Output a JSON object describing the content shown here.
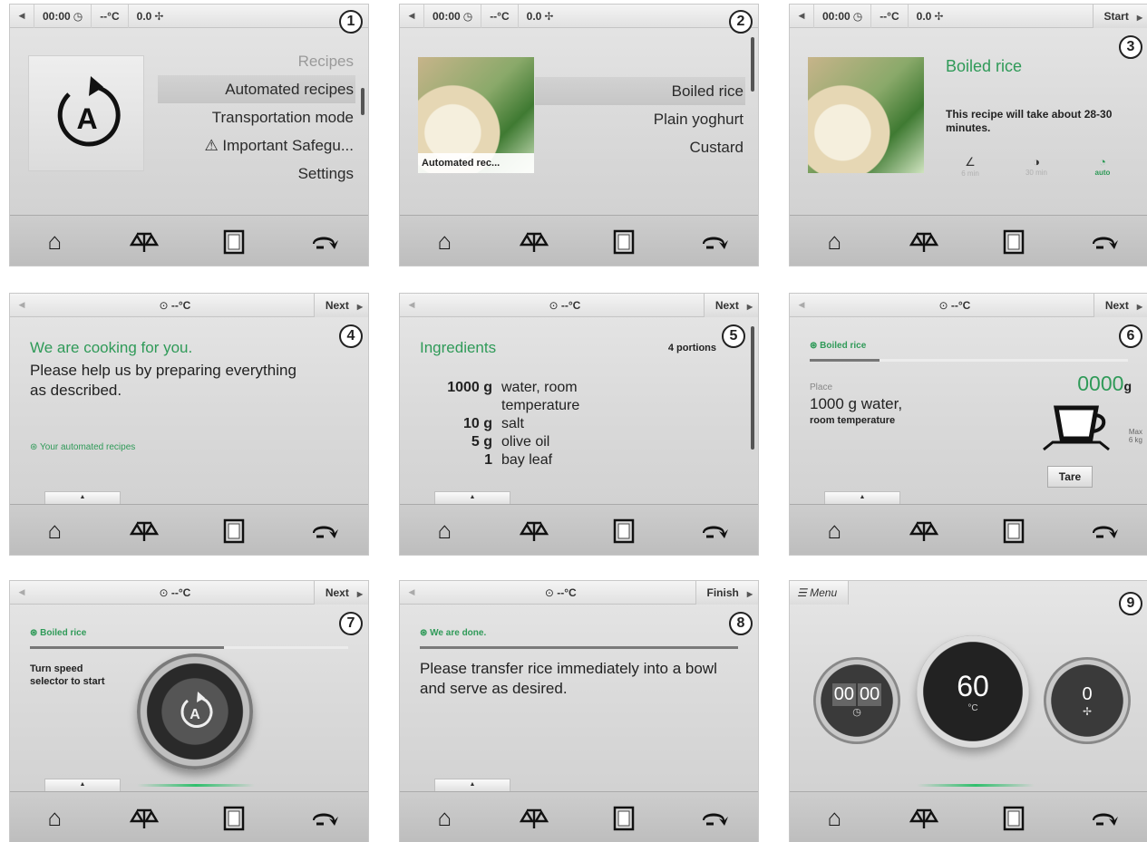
{
  "panels": [
    {
      "number": "1",
      "status": {
        "time": "00:00",
        "temp": "--°C",
        "speed": "0.0"
      },
      "menu": [
        "Recipes",
        "Automated recipes",
        "Transportation mode",
        "⚠ Important Safegu...",
        "Settings"
      ]
    },
    {
      "number": "2",
      "status": {
        "time": "00:00",
        "temp": "--°C",
        "speed": "0.0"
      },
      "photo_caption": "Automated rec...",
      "recipes": [
        "Boiled rice",
        "Plain yoghurt",
        "Custard"
      ]
    },
    {
      "number": "3",
      "status": {
        "time": "00:00",
        "temp": "--°C",
        "speed": "0.0",
        "button": "Start"
      },
      "title": "Boiled rice",
      "description": "This recipe will take about 28-30 minutes.",
      "options": [
        "6 min",
        "30 min",
        "auto"
      ]
    },
    {
      "number": "4",
      "status": {
        "temp": "--°C",
        "button": "Next"
      },
      "heading": "We are cooking for you.",
      "body": "Please help us by preparing everything as described.",
      "link": "Your automated recipes"
    },
    {
      "number": "5",
      "status": {
        "temp": "--°C",
        "button": "Next"
      },
      "heading": "Ingredients",
      "portions": "4 portions",
      "ingredients": [
        {
          "qty": "1000 g",
          "name": "water, room"
        },
        {
          "qty": "",
          "name": "temperature"
        },
        {
          "qty": "10 g",
          "name": "salt"
        },
        {
          "qty": "5 g",
          "name": "olive oil"
        },
        {
          "qty": "1",
          "name": "bay leaf"
        }
      ]
    },
    {
      "number": "6",
      "status": {
        "temp": "--°C",
        "button": "Next"
      },
      "recipe": "Boiled rice",
      "progress": 0.22,
      "place_label": "Place",
      "instruction": "1000 g water,",
      "sub_instruction": "room temperature",
      "weight": "0000",
      "weight_unit": "g",
      "max_label": "Max",
      "max_value": "6 kg",
      "tare": "Tare"
    },
    {
      "number": "7",
      "status": {
        "temp": "--°C",
        "button": "Next"
      },
      "recipe": "Boiled rice",
      "progress": 0.61,
      "instruction": "Turn speed selector to start"
    },
    {
      "number": "8",
      "status": {
        "temp": "--°C",
        "button": "Finish"
      },
      "heading": "We are done.",
      "body": "Please transfer rice immediately into a bowl and serve as desired."
    },
    {
      "number": "9",
      "menu_label": "Menu",
      "timer": {
        "minutes": "00",
        "seconds": "00"
      },
      "temperature": {
        "value": "60",
        "unit": "°C"
      },
      "speed": {
        "value": "0"
      }
    }
  ],
  "icons": {
    "nav": [
      "home-icon",
      "scale-icon",
      "book-icon",
      "reverse-icon"
    ],
    "status": [
      "clock-icon",
      "speed-icon"
    ]
  },
  "colors": {
    "accent": "#2f9a58",
    "dark": "#1a1a1a",
    "panel_bg": "#dadada"
  }
}
